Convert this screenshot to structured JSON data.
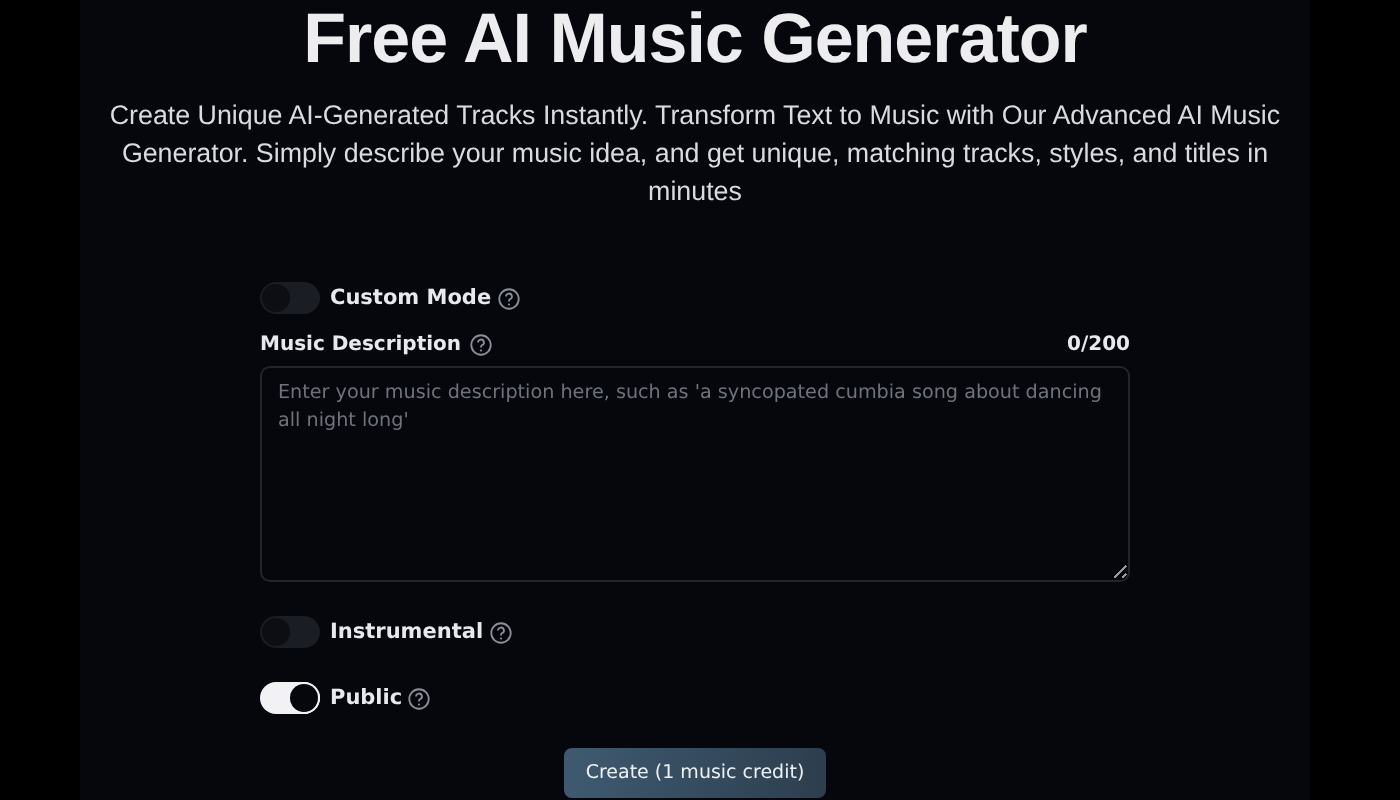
{
  "title": "Free AI Music Generator",
  "subtitle": "Create Unique AI-Generated Tracks Instantly. Transform Text to Music with Our Advanced AI Music Generator. Simply describe your music idea, and get unique, matching tracks, styles, and titles in minutes",
  "custom_mode": {
    "label": "Custom Mode",
    "on": false
  },
  "description": {
    "label": "Music Description",
    "counter": "0/200",
    "placeholder": "Enter your music description here, such as 'a syncopated cumbia song about dancing all night long'"
  },
  "toggles": [
    {
      "label": "Instrumental",
      "on": false
    },
    {
      "label": "Public",
      "on": true
    }
  ],
  "button": "Create (1 music credit)"
}
